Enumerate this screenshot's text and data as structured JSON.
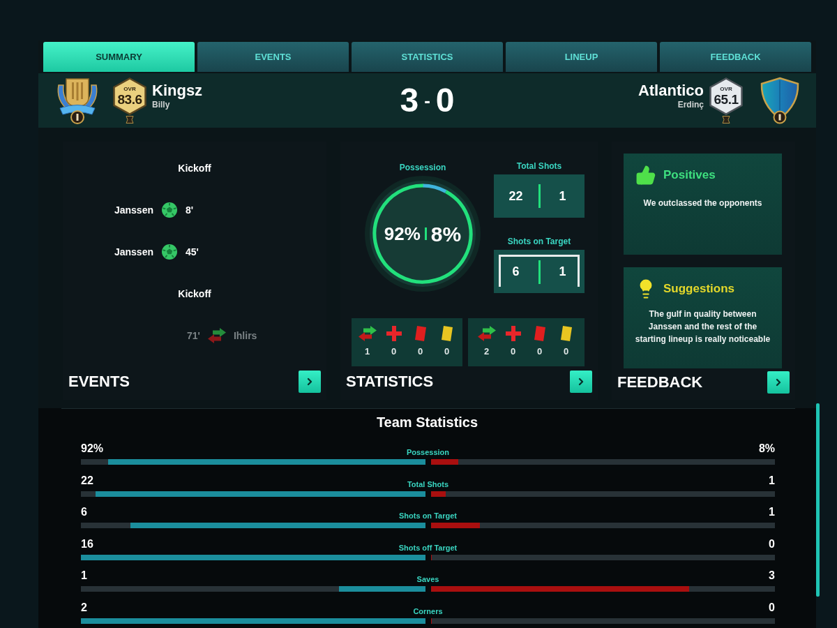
{
  "tabs": [
    {
      "label": "SUMMARY",
      "selected": true
    },
    {
      "label": "EVENTS",
      "selected": false
    },
    {
      "label": "STATISTICS",
      "selected": false
    },
    {
      "label": "LINEUP",
      "selected": false
    },
    {
      "label": "FEEDBACK",
      "selected": false
    }
  ],
  "match": {
    "home": {
      "crest": {
        "kind": "trophy"
      },
      "badge": {
        "kind": "gold"
      },
      "ovr_label": "OVR",
      "ovr": "83.6",
      "name": "Kingsz",
      "manager": "Billy"
    },
    "score": {
      "home": "3",
      "separator": "-",
      "away": "0"
    },
    "away": {
      "crest": {
        "kind": "shield"
      },
      "badge": {
        "kind": "silver"
      },
      "ovr_label": "OVR",
      "ovr": "65.1",
      "name": "Atlantico",
      "manager": "Erdinç"
    }
  },
  "events_panel": {
    "title": "EVENTS",
    "items": [
      {
        "kind": "kickoff",
        "label": "Kickoff"
      },
      {
        "kind": "goal",
        "away": false,
        "player": "Janssen",
        "minute": "8'"
      },
      {
        "kind": "goal",
        "away": false,
        "player": "Janssen",
        "minute": "45'"
      },
      {
        "kind": "kickoff",
        "label": "Kickoff"
      },
      {
        "kind": "substitution",
        "away": true,
        "player": "Ihlirs",
        "minute": "71'"
      }
    ]
  },
  "statistics_panel": {
    "title": "STATISTICS",
    "possession": {
      "label": "Possession",
      "home": "92%",
      "away": "8%",
      "level": 0.92
    },
    "total_shots": {
      "label": "Total Shots",
      "home": "22",
      "away": "1"
    },
    "shots_on_target": {
      "label": "Shots on Target",
      "home": "6",
      "away": "1"
    },
    "discipline": [
      {
        "items": [
          {
            "kind": "substitutions",
            "value": "1"
          },
          {
            "kind": "injuries",
            "value": "0"
          },
          {
            "kind": "red_cards",
            "value": "0"
          },
          {
            "kind": "yellow_cards",
            "value": "0"
          }
        ]
      },
      {
        "items": [
          {
            "kind": "substitutions",
            "value": "2"
          },
          {
            "kind": "injuries",
            "value": "0"
          },
          {
            "kind": "red_cards",
            "value": "0"
          },
          {
            "kind": "yellow_cards",
            "value": "0"
          }
        ]
      }
    ]
  },
  "feedback_panel": {
    "title": "FEEDBACK",
    "cards": [
      {
        "kind": "positive",
        "title": "Positives",
        "text": "We outclassed the opponents"
      },
      {
        "kind": "suggestion",
        "title": "Suggestions",
        "text": "The gulf in quality between Janssen and the rest of the starting lineup is really noticeable"
      }
    ]
  },
  "team_statistics": {
    "title": "Team Statistics",
    "rows": [
      {
        "label": "Possession",
        "home": {
          "value": "92%",
          "level": 0.92
        },
        "away": {
          "value": "8%",
          "level": 0.08
        }
      },
      {
        "label": "Total Shots",
        "home": {
          "value": "22",
          "level": 0.957
        },
        "away": {
          "value": "1",
          "level": 0.043
        }
      },
      {
        "label": "Shots on Target",
        "home": {
          "value": "6",
          "level": 0.857
        },
        "away": {
          "value": "1",
          "level": 0.143
        }
      },
      {
        "label": "Shots off Target",
        "home": {
          "value": "16",
          "level": 1
        },
        "away": {
          "value": "0",
          "level": 0
        }
      },
      {
        "label": "Saves",
        "home": {
          "value": "1",
          "level": 0.25
        },
        "away": {
          "value": "3",
          "level": 0.75
        }
      },
      {
        "label": "Corners",
        "home": {
          "value": "2",
          "level": 1
        },
        "away": {
          "value": "0",
          "level": 0
        }
      }
    ]
  }
}
